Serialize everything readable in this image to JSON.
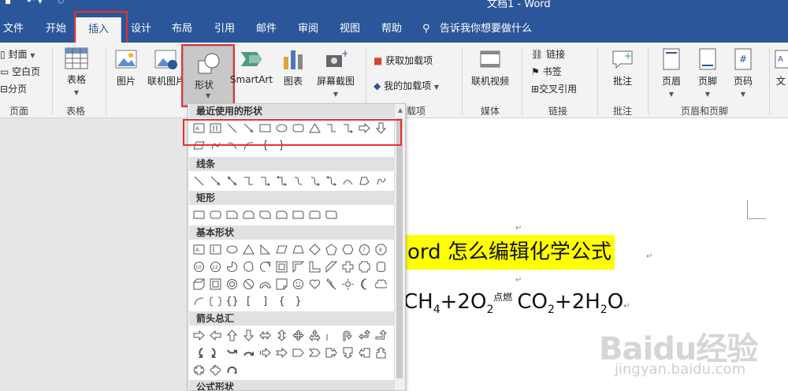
{
  "window": {
    "title": "文档1 - Word"
  },
  "tabs": [
    "文件",
    "开始",
    "插入",
    "设计",
    "布局",
    "引用",
    "邮件",
    "审阅",
    "视图",
    "帮助"
  ],
  "tell_me": "告诉我你想要做什么",
  "ribbon": {
    "pages_group": {
      "cover": "封面",
      "blank": "空白页",
      "break": "分页",
      "label": "页面"
    },
    "table_group": {
      "table": "表格",
      "label": "表格"
    },
    "illus": {
      "picture": "图片",
      "online_picture": "联机图片",
      "shapes": "形状",
      "smartart": "SmartArt",
      "chart": "图表",
      "screenshot": "屏幕截图"
    },
    "addins": {
      "get": "获取加载项",
      "mine": "我的加载项",
      "label_tail": "载项"
    },
    "media": {
      "online_video": "联机视频",
      "label": "媒体"
    },
    "links": {
      "link": "链接",
      "bookmark": "书签",
      "crossref": "交叉引用",
      "label": "链接"
    },
    "comments": {
      "comment": "批注",
      "label": "批注"
    },
    "hf": {
      "header": "页眉",
      "footer": "页脚",
      "page_num": "页码",
      "label": "页眉和页脚"
    },
    "text_tail": "文"
  },
  "dropdown": {
    "sections": [
      "最近使用的形状",
      "线条",
      "矩形",
      "基本形状",
      "箭头总汇",
      "公式形状"
    ]
  },
  "document": {
    "heading": "ord 怎么编辑化学公式",
    "formula": {
      "ch": "CH",
      "n4": "4",
      "plus1": "+2O",
      "n2a": "2",
      "co": "CO",
      "n2b": "2",
      "plus2": "+2H",
      "n2c": "2",
      "o": "O"
    },
    "condition": "点燃"
  },
  "watermark": {
    "brand": "Baidu经验",
    "url": "jingyan.baidu.com"
  },
  "colors": {
    "accent": "#2b579a",
    "highlight": "#ffff00",
    "annotation": "#e8312f"
  }
}
